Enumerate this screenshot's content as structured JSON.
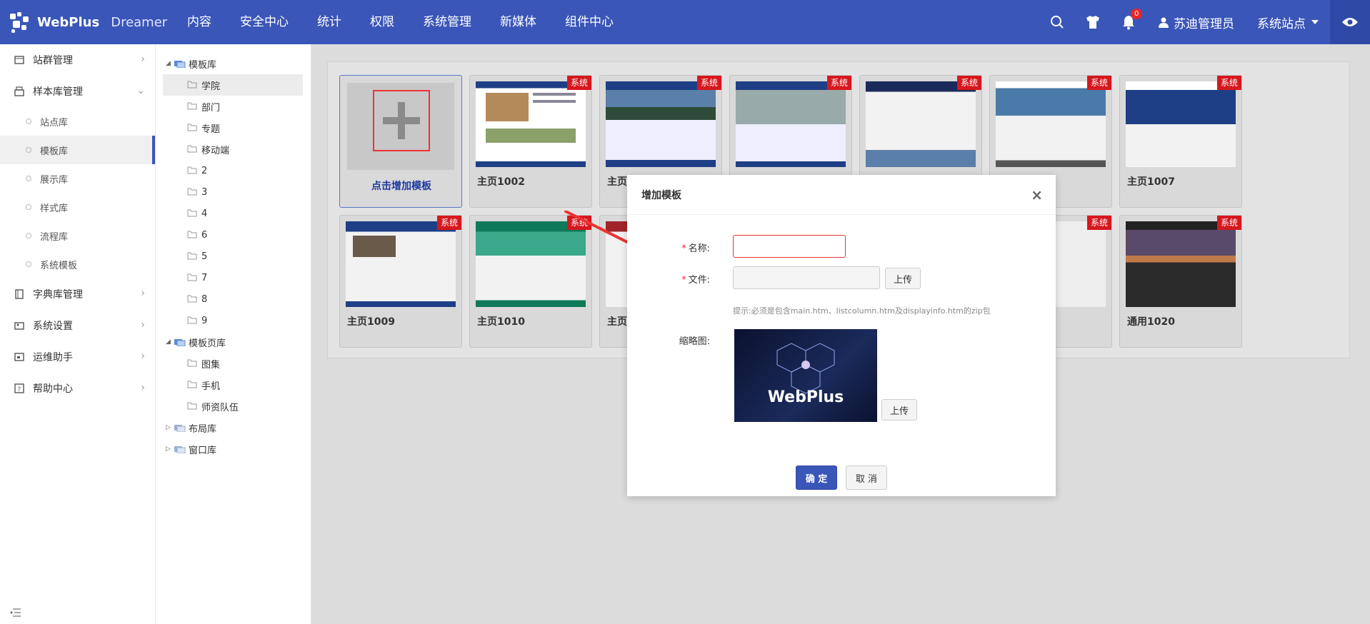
{
  "brand": {
    "name": "WebPlus",
    "sub": "Dreamer"
  },
  "topnav": [
    "内容",
    "安全中心",
    "统计",
    "权限",
    "系统管理",
    "新媒体",
    "组件中心"
  ],
  "header": {
    "notif_count": "0",
    "user_name": "苏迪管理员",
    "site_name": "系统站点"
  },
  "sidebar": {
    "items": [
      {
        "label": "站群管理",
        "icon": "site-group-icon"
      },
      {
        "label": "样本库管理",
        "icon": "sample-lib-icon"
      },
      {
        "label": "字典库管理",
        "icon": "dict-icon"
      },
      {
        "label": "系统设置",
        "icon": "settings-icon"
      },
      {
        "label": "运维助手",
        "icon": "ops-icon"
      },
      {
        "label": "帮助中心",
        "icon": "help-icon"
      }
    ],
    "sub": [
      "站点库",
      "模板库",
      "展示库",
      "样式库",
      "流程库",
      "系统模板"
    ],
    "active_sub": "模板库"
  },
  "tree": {
    "root1": "模板库",
    "children1": [
      "学院",
      "部门",
      "专题",
      "移动端",
      "2",
      "3",
      "4",
      "6",
      "5",
      "7",
      "8",
      "9"
    ],
    "root2": "模板页库",
    "children2": [
      "图集",
      "手机",
      "师资队伍"
    ],
    "root3": "布局库",
    "root4": "窗口库"
  },
  "cards": {
    "add_label": "点击增加模板",
    "tag": "系统",
    "row1": [
      "主页1002",
      "主页",
      "",
      "",
      "",
      "主页1007"
    ],
    "row2": [
      "主页1009",
      "主页1010",
      "主页",
      "",
      "",
      "通用1020"
    ]
  },
  "modal": {
    "title": "增加模板",
    "name_label": "名称:",
    "file_label": "文件:",
    "upload": "上传",
    "hint": "提示:必须是包含main.htm、listcolumn.htm及displayinfo.htm的zip包",
    "thumb_label": "缩略图:",
    "thumb_brand": "WebPlus",
    "ok": "确 定",
    "cancel": "取 消"
  },
  "colors": {
    "primary": "#3a56b8",
    "tag": "#d6181e",
    "error": "#e33333"
  }
}
